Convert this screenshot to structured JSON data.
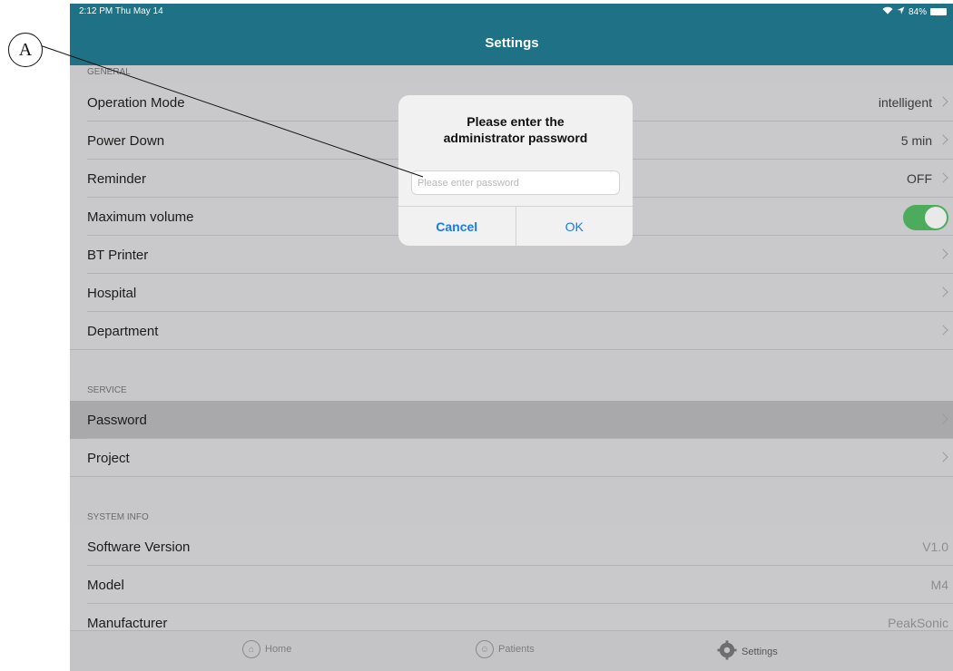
{
  "callout": {
    "label": "A"
  },
  "status_bar": {
    "time": "2:12 PM  Thu May 14",
    "battery": "84%"
  },
  "nav": {
    "title": "Settings"
  },
  "sections": {
    "general": {
      "header": "GENERAL",
      "rows": [
        {
          "label": "Operation Mode",
          "value": "intelligent"
        },
        {
          "label": "Power Down",
          "value": "5 min"
        },
        {
          "label": "Reminder",
          "value": "OFF"
        },
        {
          "label": "Maximum volume",
          "toggle_on": true
        },
        {
          "label": "BT Printer"
        },
        {
          "label": "Hospital"
        },
        {
          "label": "Department"
        }
      ]
    },
    "service": {
      "header": "SERVICE",
      "rows": [
        {
          "label": "Password"
        },
        {
          "label": "Project"
        }
      ]
    },
    "system_info": {
      "header": "SYSTEM INFO",
      "rows": [
        {
          "label": "Software Version",
          "value": "V1.0"
        },
        {
          "label": "Model",
          "value": "M4"
        },
        {
          "label": "Manufacturer",
          "value": "PeakSonic"
        }
      ]
    }
  },
  "dialog": {
    "title": "Please enter the\nadministrator password",
    "input_placeholder": "Please enter password",
    "input_value": "",
    "cancel_label": "Cancel",
    "ok_label": "OK"
  },
  "tabbar": {
    "items": [
      {
        "label": "Home",
        "icon": "home-icon"
      },
      {
        "label": "Patients",
        "icon": "patients-icon"
      },
      {
        "label": "Settings",
        "icon": "gear-icon",
        "active": true
      }
    ]
  },
  "colors": {
    "header_bar": "#1f7285",
    "accent_blue": "#1a7ae8",
    "toggle_green": "#4cab5c"
  }
}
